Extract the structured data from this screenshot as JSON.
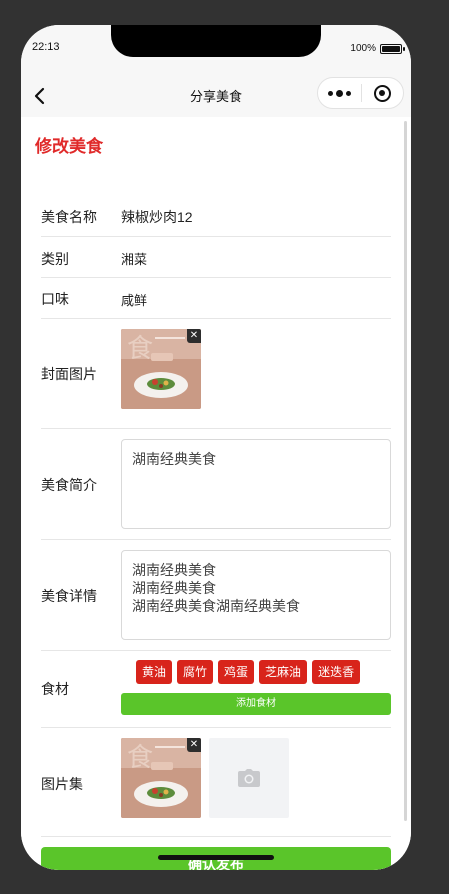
{
  "status": {
    "time": "22:13",
    "battery": "100%"
  },
  "nav": {
    "title": "分享美食"
  },
  "page": {
    "title": "修改美食"
  },
  "form": {
    "name_label": "美食名称",
    "name_value": "辣椒炒肉12",
    "category_label": "类别",
    "category_value": "湘菜",
    "taste_label": "口味",
    "taste_value": "咸鲜",
    "cover_label": "封面图片",
    "intro_label": "美食简介",
    "intro_value": "湖南经典美食",
    "detail_label": "美食详情",
    "detail_lines": [
      "湖南经典美食",
      "湖南经典美食",
      "湖南经典美食湖南经典美食"
    ],
    "ingredients_label": "食材",
    "ingredients": [
      "黄油",
      "腐竹",
      "鸡蛋",
      "芝麻油",
      "迷迭香"
    ],
    "add_ingredient_label": "添加食材",
    "gallery_label": "图片集",
    "submit_label": "确认发布"
  },
  "icons": {
    "back": "chevron-left-icon",
    "more": "more-dots-icon",
    "close": "target-circle-icon",
    "delete": "close-icon",
    "camera": "camera-icon"
  },
  "colors": {
    "accent_red": "#e02a2a",
    "tag_red": "#d8241b",
    "green": "#5ac52a"
  }
}
